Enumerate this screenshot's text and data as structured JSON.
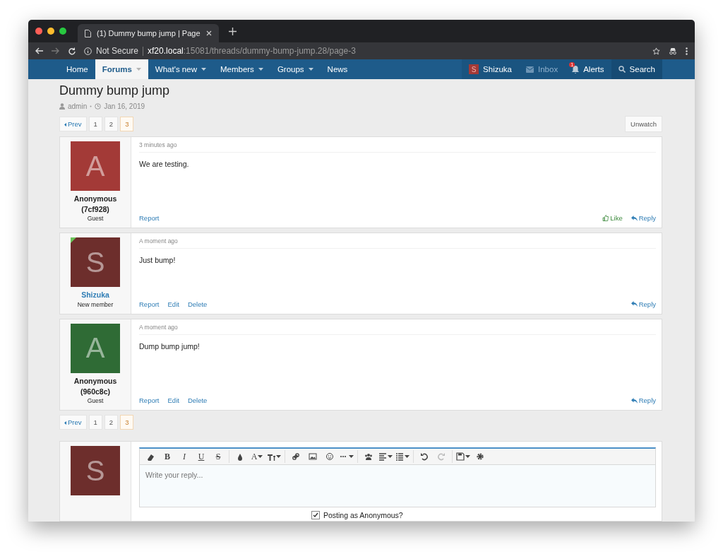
{
  "browser": {
    "tab_title": "(1) Dummy bump jump | Page",
    "security": "Not Secure",
    "url_host": "xf20.local",
    "url_path": ":15081/threads/dummy-bump-jump.28/page-3"
  },
  "nav": {
    "items": [
      {
        "label": "Home",
        "selected": false,
        "dropdown": false
      },
      {
        "label": "Forums",
        "selected": true,
        "dropdown": true
      },
      {
        "label": "What's new",
        "selected": false,
        "dropdown": true
      },
      {
        "label": "Members",
        "selected": false,
        "dropdown": true
      },
      {
        "label": "Groups",
        "selected": false,
        "dropdown": true
      },
      {
        "label": "News",
        "selected": false,
        "dropdown": false
      }
    ],
    "user": {
      "avatar_letter": "S",
      "name": "Shizuka"
    },
    "inbox": {
      "label": "Inbox",
      "disabled": true
    },
    "alerts": {
      "label": "Alerts",
      "badge": "1"
    },
    "search": {
      "label": "Search"
    }
  },
  "thread": {
    "title": "Dummy bump jump",
    "author": "admin",
    "date": "Jan 16, 2019",
    "watch_button": "Unwatch"
  },
  "pagination_top": {
    "prev": "Prev",
    "pages": [
      {
        "label": "1",
        "selected": false
      },
      {
        "label": "2",
        "selected": false
      },
      {
        "label": "3",
        "selected": true
      }
    ]
  },
  "posts": [
    {
      "avatar_letter": "A",
      "color": "#a33a37",
      "name": "Anonymous (7cf928)",
      "name_link": false,
      "user_title": "Guest",
      "online": false,
      "time": "3 minutes ago",
      "message": "We are testing.",
      "actions_left": [
        "Report"
      ],
      "actions_right": [
        {
          "kind": "like",
          "label": "Like"
        },
        {
          "kind": "reply",
          "label": "Reply"
        }
      ]
    },
    {
      "avatar_letter": "S",
      "color": "#6d2e2c",
      "name": "Shizuka",
      "name_link": true,
      "user_title": "New member",
      "online": true,
      "time": "A moment ago",
      "message": "Just bump!",
      "actions_left": [
        "Report",
        "Edit",
        "Delete"
      ],
      "actions_right": [
        {
          "kind": "reply",
          "label": "Reply"
        }
      ]
    },
    {
      "avatar_letter": "A",
      "color": "#2f6b35",
      "name": "Anonymous (960c8c)",
      "name_link": false,
      "user_title": "Guest",
      "online": false,
      "time": "A moment ago",
      "message": "Dump bump jump!",
      "actions_left": [
        "Report",
        "Edit",
        "Delete"
      ],
      "actions_right": [
        {
          "kind": "reply",
          "label": "Reply"
        }
      ]
    }
  ],
  "pagination_bottom": {
    "prev": "Prev",
    "pages": [
      {
        "label": "1",
        "selected": false
      },
      {
        "label": "2",
        "selected": false
      },
      {
        "label": "3",
        "selected": true
      }
    ]
  },
  "reply": {
    "avatar_letter": "S",
    "color": "#6d2e2c",
    "toolbar": [
      {
        "kind": "eraser"
      },
      {
        "kind": "bold",
        "label": "B"
      },
      {
        "kind": "italic",
        "label": "I"
      },
      {
        "kind": "underline",
        "label": "U"
      },
      {
        "kind": "strike",
        "label": "S"
      },
      {
        "kind": "sep"
      },
      {
        "kind": "drop"
      },
      {
        "kind": "font",
        "label": "A"
      },
      {
        "kind": "fontsize"
      },
      {
        "kind": "sep"
      },
      {
        "kind": "link"
      },
      {
        "kind": "image"
      },
      {
        "kind": "smile"
      },
      {
        "kind": "more"
      },
      {
        "kind": "sep"
      },
      {
        "kind": "users"
      },
      {
        "kind": "align"
      },
      {
        "kind": "list"
      },
      {
        "kind": "sep"
      },
      {
        "kind": "undo"
      },
      {
        "kind": "redo"
      },
      {
        "kind": "sep"
      },
      {
        "kind": "save"
      },
      {
        "kind": "gear"
      }
    ],
    "placeholder": "Write your reply...",
    "anonymous_option": {
      "label": "Posting as Anonymous?",
      "checked": true
    }
  }
}
